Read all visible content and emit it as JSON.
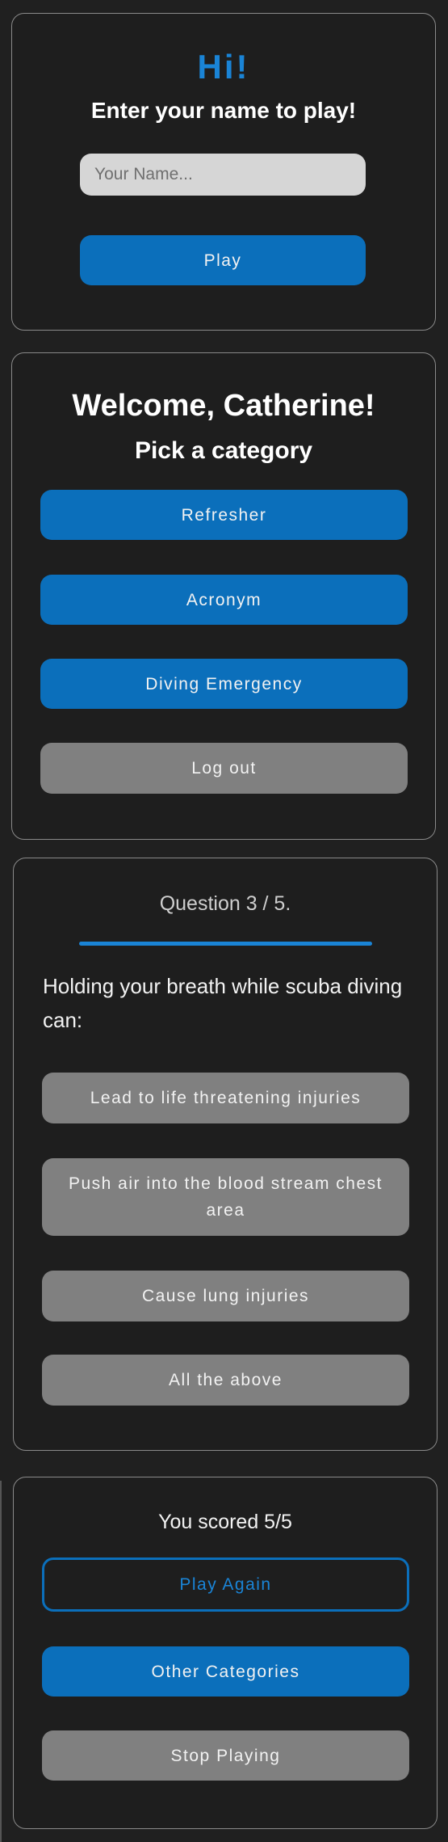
{
  "login": {
    "greeting": "Hi!",
    "prompt": "Enter your name to play!",
    "name_placeholder": "Your Name...",
    "play_label": "Play"
  },
  "menu": {
    "welcome": "Welcome, Catherine!",
    "subtitle": "Pick a category",
    "categories": [
      {
        "label": "Refresher"
      },
      {
        "label": "Acronym"
      },
      {
        "label": "Diving Emergency"
      }
    ],
    "logout_label": "Log out"
  },
  "quiz": {
    "counter": "Question 3 / 5.",
    "progress": 0.6,
    "question": "Holding your breath while scuba diving can:",
    "answers": [
      {
        "label": "Lead to life threatening injuries"
      },
      {
        "label": "Push air into the blood stream chest area"
      },
      {
        "label": "Cause lung injuries"
      },
      {
        "label": "All the above"
      }
    ]
  },
  "result": {
    "score_text": "You scored 5/5",
    "play_again_label": "Play Again",
    "other_categories_label": "Other Categories",
    "stop_playing_label": "Stop Playing"
  },
  "colors": {
    "accent": "#0b6fbb",
    "accent_text": "#1a84d6",
    "neutral_button": "#808080",
    "card_background": "#1e1e1e",
    "page_background": "#202020"
  }
}
